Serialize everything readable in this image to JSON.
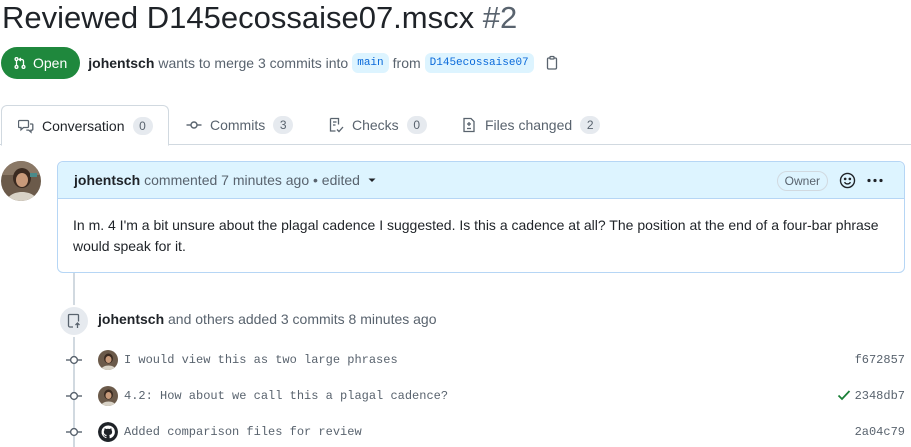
{
  "pr": {
    "title": "Reviewed D145ecossaise07.mscx",
    "number": "#2",
    "state": "Open",
    "author": "johentsch",
    "merge_text": "wants to merge 3 commits into",
    "base_branch": "main",
    "from_text": "from",
    "head_branch": "D145ecossaise07"
  },
  "tabs": [
    {
      "label": "Conversation",
      "count": "0"
    },
    {
      "label": "Commits",
      "count": "3"
    },
    {
      "label": "Checks",
      "count": "0"
    },
    {
      "label": "Files changed",
      "count": "2"
    }
  ],
  "comment": {
    "author": "johentsch",
    "action": "commented 7 minutes ago • edited",
    "role": "Owner",
    "body": "In m. 4 I'm a bit unsure about the plagal cadence I suggested. Is this a cadence at all? The position at the end of a four-bar phrase would speak for it."
  },
  "event": {
    "author": "johentsch",
    "text": "and others added 3 commits 8 minutes ago"
  },
  "commits": [
    {
      "message": "I would view this as two large phrases",
      "sha": "f672857",
      "check": false,
      "avatar": "user"
    },
    {
      "message": "4.2: How about we call this a plagal cadence?",
      "sha": "2348db7",
      "check": true,
      "avatar": "user"
    },
    {
      "message": "Added comparison files for review",
      "sha": "2a04c79",
      "check": false,
      "avatar": "github"
    }
  ],
  "colors": {
    "open_green": "#1f883d",
    "link_blue": "#0969da",
    "comment_header_bg": "#ddf4ff"
  }
}
